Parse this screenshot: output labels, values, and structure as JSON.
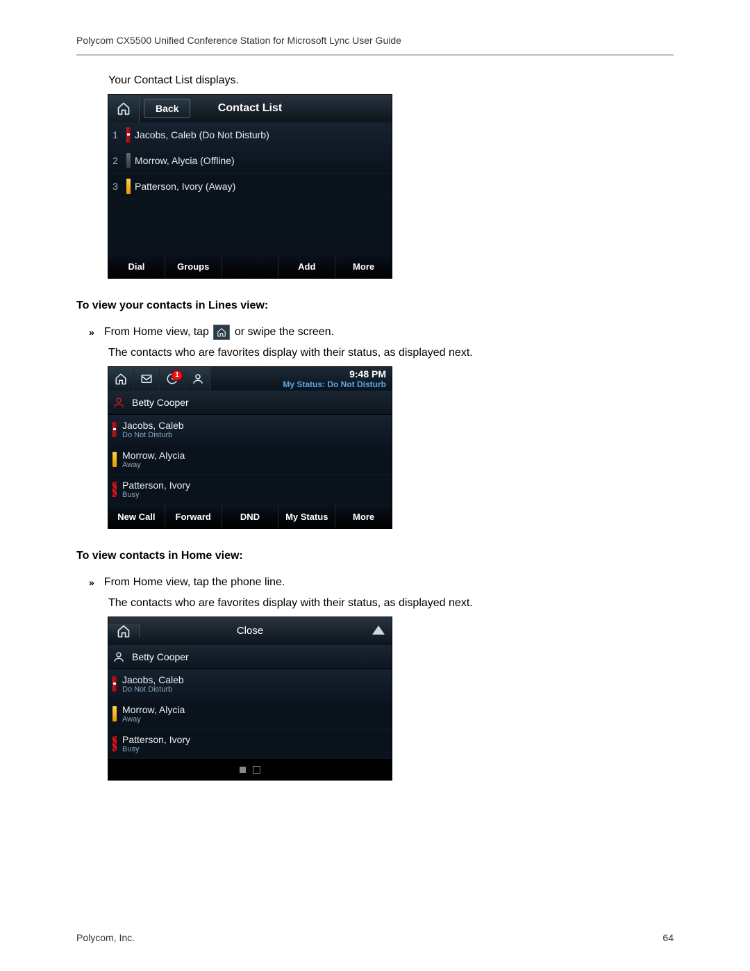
{
  "header": "Polycom CX5500 Unified Conference Station for Microsoft Lync User Guide",
  "intro": "Your Contact List displays.",
  "screen1": {
    "back": "Back",
    "title": "Contact List",
    "rows": [
      {
        "n": "1",
        "name": "Jacobs, Caleb (Do Not Disturb)",
        "p": "dnd"
      },
      {
        "n": "2",
        "name": "Morrow, Alycia (Offline)",
        "p": "offline"
      },
      {
        "n": "3",
        "name": "Patterson, Ivory (Away)",
        "p": "away"
      }
    ],
    "keys": [
      "Dial",
      "Groups",
      "",
      "Add",
      "More"
    ]
  },
  "h2": "To view your contacts in Lines view:",
  "bullet1a": "From Home view, tap ",
  "bullet1b": " or swipe the screen.",
  "para1": "The contacts who are favorites display with their status, as displayed next.",
  "screen2": {
    "clock": "9:48 PM",
    "status": "My Status: Do Not Disturb",
    "badge": "1",
    "user": "Betty Cooper",
    "rows": [
      {
        "name": "Jacobs, Caleb",
        "sub": "Do Not Disturb",
        "p": "dnd"
      },
      {
        "name": "Morrow, Alycia",
        "sub": "Away",
        "p": "away"
      },
      {
        "name": "Patterson, Ivory",
        "sub": "Busy",
        "p": "busy"
      }
    ],
    "keys": [
      "New Call",
      "Forward",
      "DND",
      "My Status",
      "More"
    ]
  },
  "h3": "To view contacts in Home view:",
  "bullet2": "From Home view, tap the phone line.",
  "para2": "The contacts who are favorites display with their status, as displayed next.",
  "screen3": {
    "close": "Close",
    "user": "Betty Cooper",
    "rows": [
      {
        "name": "Jacobs, Caleb",
        "sub": "Do Not Disturb",
        "p": "dnd"
      },
      {
        "name": "Morrow, Alycia",
        "sub": "Away",
        "p": "away"
      },
      {
        "name": "Patterson, Ivory",
        "sub": "Busy",
        "p": "busy"
      }
    ]
  },
  "footer_left": "Polycom, Inc.",
  "footer_right": "64"
}
